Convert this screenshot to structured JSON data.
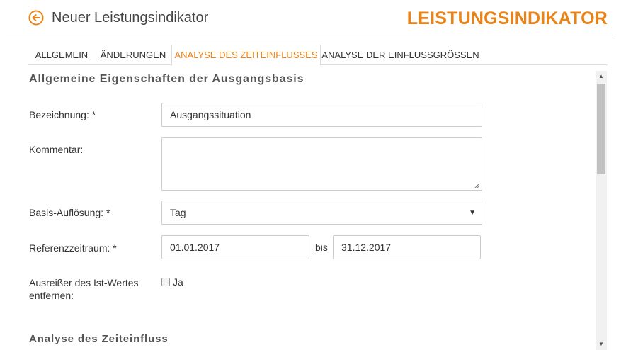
{
  "header": {
    "title": "Neuer Leistungsindikator",
    "brand": "LEISTUNGSINDIKATOR",
    "accent_color": "#e8831a",
    "back_icon": "arrow-left-circle-icon"
  },
  "tabs": [
    {
      "label": "ALLGEMEIN",
      "active": false
    },
    {
      "label": "ÄNDERUNGEN",
      "active": false
    },
    {
      "label": "ANALYSE DES ZEITEINFLUSSES",
      "active": true
    },
    {
      "label": "ANALYSE DER EINFLUSSGRÖSSEN",
      "active": false
    }
  ],
  "form": {
    "section_title": "Allgemeine Eigenschaften der Ausgangsbasis",
    "bezeichnung": {
      "label": "Bezeichnung: *",
      "value": "Ausgangssituation"
    },
    "kommentar": {
      "label": "Kommentar:",
      "value": ""
    },
    "basis_aufloesung": {
      "label": "Basis-Auflösung: *",
      "value": "Tag"
    },
    "referenzzeitraum": {
      "label": "Referenzzeitraum: *",
      "from": "01.01.2017",
      "separator": "bis",
      "to": "31.12.2017"
    },
    "ausreisser": {
      "label_line1": "Ausreißer des Ist-Wertes",
      "label_line2": "entfernen:",
      "checkbox_label": "Ja",
      "checked": false
    }
  },
  "analysis": {
    "section_title": "Analyse des Zeiteinfluss"
  }
}
